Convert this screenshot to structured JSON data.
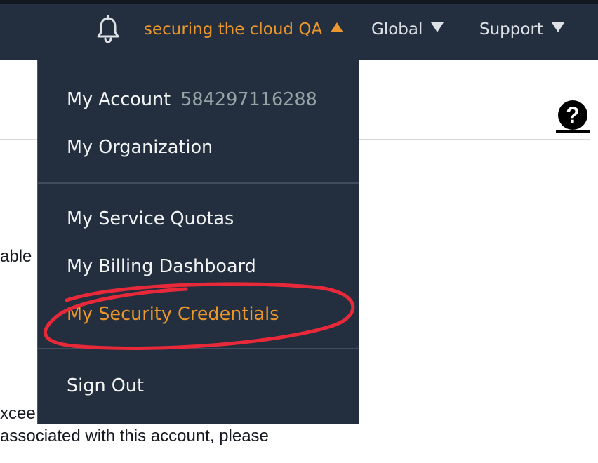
{
  "topbar": {
    "account_label": "securing the cloud QA",
    "region_label": "Global",
    "support_label": "Support",
    "icons": {
      "notifications": "bell-icon",
      "account_toggle": "caret-up-icon",
      "region_toggle": "caret-down-icon",
      "support_toggle": "caret-down-icon"
    }
  },
  "account_menu": {
    "items": [
      {
        "label": "My Account",
        "detail": "584297116288"
      },
      {
        "label": "My Organization"
      },
      {
        "label": "My Service Quotas"
      },
      {
        "label": "My Billing Dashboard"
      },
      {
        "label": "My Security Credentials",
        "highlighted": true
      },
      {
        "label": "Sign Out"
      }
    ]
  },
  "background": {
    "text_fragment_1": "able",
    "text_fragment_2": "xcee",
    "text_fragment_3": "associated with this account, please",
    "help_icon": "question-circle-icon"
  },
  "colors": {
    "nav_background": "#232f3e",
    "accent": "#ec972b",
    "annotation": "#e8293a"
  }
}
